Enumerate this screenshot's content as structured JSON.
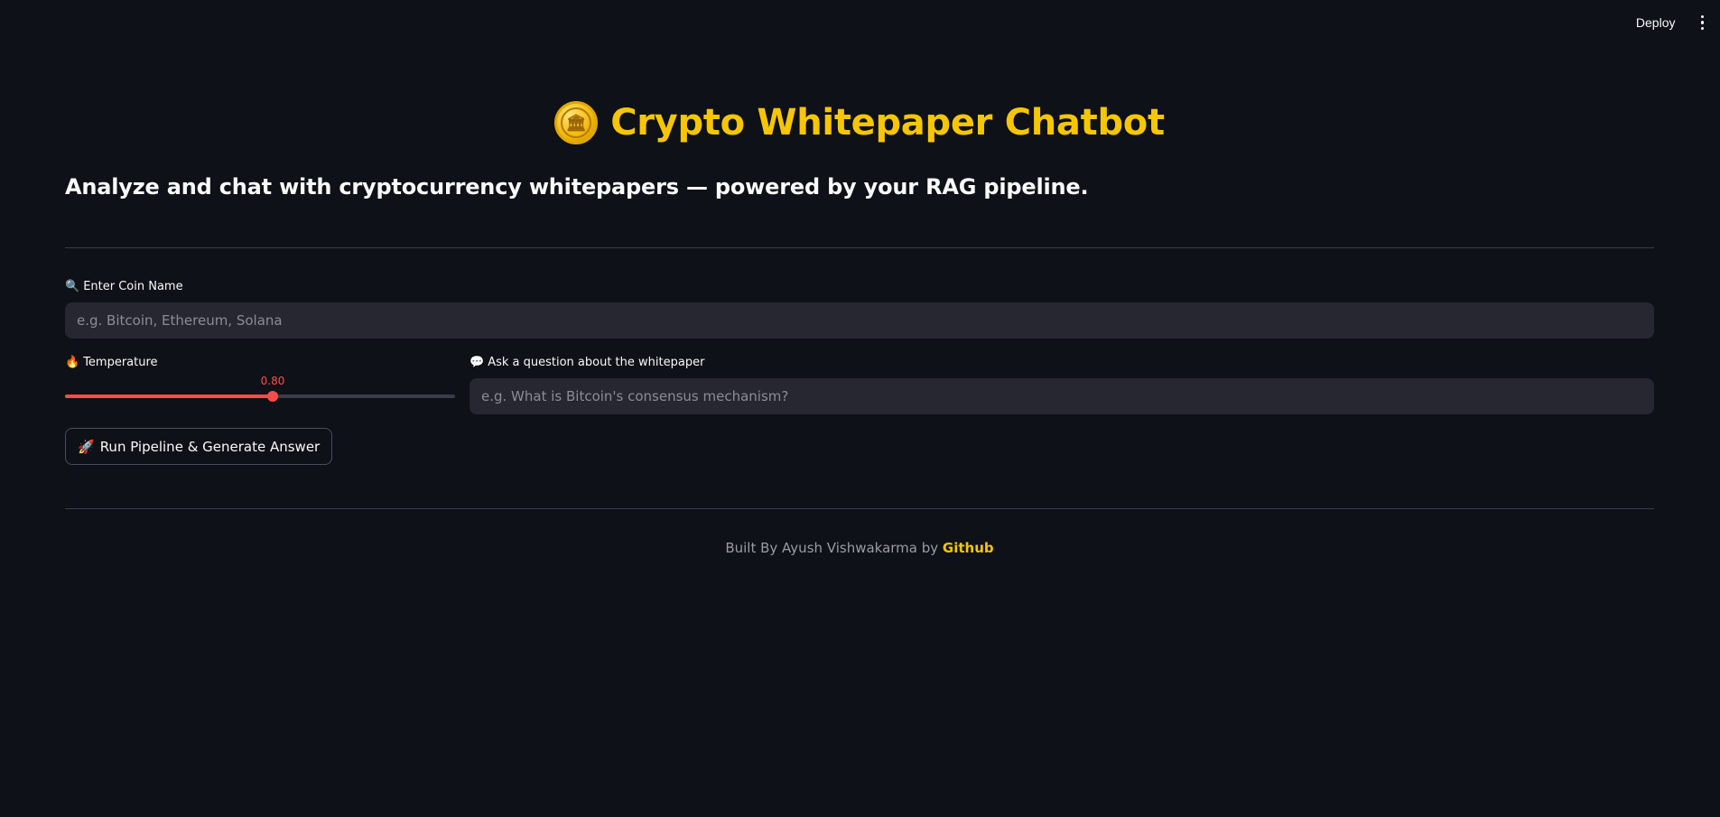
{
  "header": {
    "deploy_label": "Deploy",
    "menu_icon": "kebab-vertical-icon"
  },
  "hero": {
    "title_icon": "coin-emoji",
    "title": "Crypto Whitepaper Chatbot",
    "subtitle": "Analyze and chat with cryptocurrency whitepapers — powered by your RAG pipeline."
  },
  "coin": {
    "label_icon": "🔍",
    "label": "Enter Coin Name",
    "value": "",
    "placeholder": "e.g. Bitcoin, Ethereum, Solana"
  },
  "temperature": {
    "label_icon": "🔥",
    "label": "Temperature",
    "value_text": "0.80",
    "value": 0.8,
    "min": 0,
    "max": 1.5,
    "accent_color": "#ff4b4b"
  },
  "question": {
    "label_icon": "💬",
    "label": "Ask a question about the whitepaper",
    "value": "",
    "placeholder": "e.g. What is Bitcoin's consensus mechanism?"
  },
  "run_button": {
    "icon": "🚀",
    "label": "Run Pipeline & Generate Answer"
  },
  "footer": {
    "text": "Built By Ayush Vishwakarma by ",
    "link_label": "Github"
  },
  "colors": {
    "background": "#0e1117",
    "brand": "#f7c600",
    "input_bg": "#262730"
  }
}
